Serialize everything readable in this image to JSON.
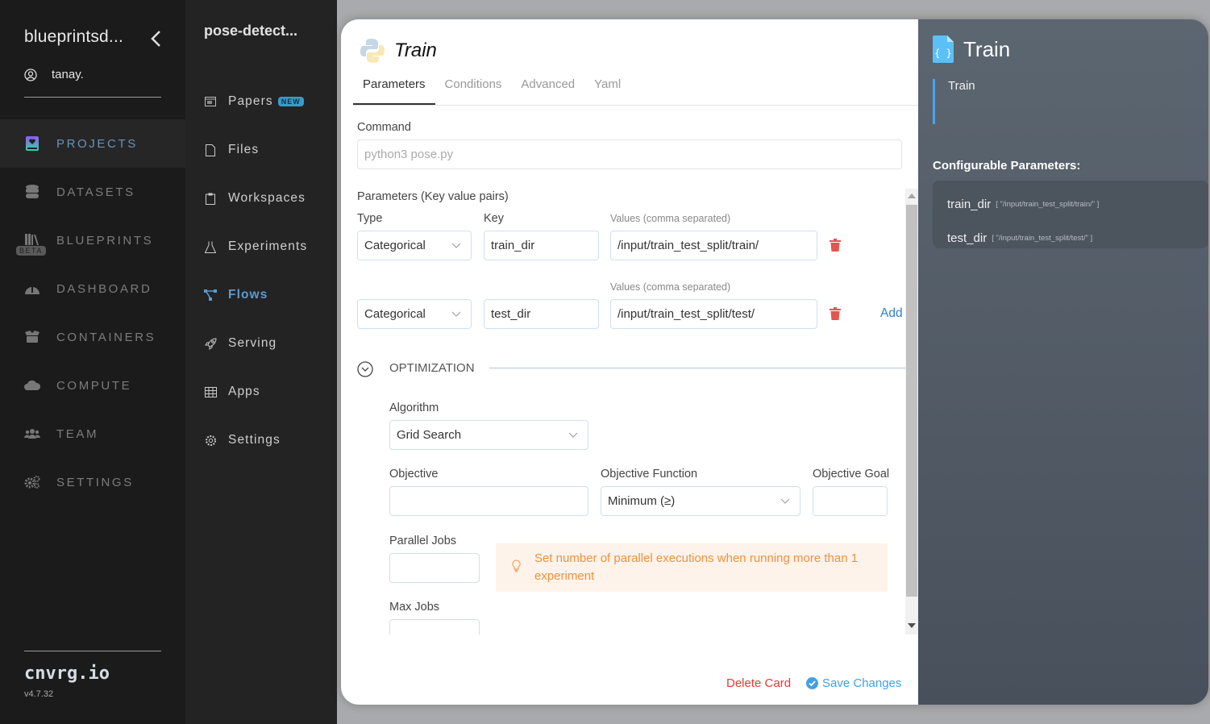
{
  "sidebar": {
    "org_name": "blueprintsd...",
    "username": "tanay.",
    "items": [
      {
        "label": "PROJECTS",
        "icon": "projects-icon",
        "active": true
      },
      {
        "label": "DATASETS",
        "icon": "database-icon"
      },
      {
        "label": "BLUEPRINTS",
        "icon": "blueprints-icon",
        "badge": "BETA"
      },
      {
        "label": "DASHBOARD",
        "icon": "dashboard-icon"
      },
      {
        "label": "CONTAINERS",
        "icon": "containers-icon"
      },
      {
        "label": "COMPUTE",
        "icon": "cloud-icon"
      },
      {
        "label": "TEAM",
        "icon": "team-icon"
      },
      {
        "label": "SETTINGS",
        "icon": "gears-icon"
      }
    ],
    "brand": "cnvrg.io",
    "version": "v4.7.32"
  },
  "project_nav": {
    "project_name": "pose-detect...",
    "items": [
      {
        "label": "Papers",
        "icon": "papers-icon",
        "badge": "NEW"
      },
      {
        "label": "Files",
        "icon": "file-icon"
      },
      {
        "label": "Workspaces",
        "icon": "clipboard-icon"
      },
      {
        "label": "Experiments",
        "icon": "flask-icon"
      },
      {
        "label": "Flows",
        "icon": "flows-icon",
        "active": true
      },
      {
        "label": "Serving",
        "icon": "rocket-icon"
      },
      {
        "label": "Apps",
        "icon": "grid-icon"
      },
      {
        "label": "Settings",
        "icon": "gear-icon"
      }
    ]
  },
  "modal": {
    "title": "Train",
    "tabs": [
      "Parameters",
      "Conditions",
      "Advanced",
      "Yaml"
    ],
    "active_tab": "Parameters",
    "command_label": "Command",
    "command_placeholder": "python3 pose.py",
    "params_label": "Parameters (Key value pairs)",
    "type_label": "Type",
    "key_label": "Key",
    "values_label": "Values (comma separated)",
    "params": [
      {
        "type": "Categorical",
        "key": "train_dir",
        "values": "/input/train_test_split/train/"
      },
      {
        "type": "Categorical",
        "key": "test_dir",
        "values": "/input/train_test_split/test/"
      }
    ],
    "add_label": "Add",
    "optimization": {
      "section_label": "OPTIMIZATION",
      "algorithm_label": "Algorithm",
      "algorithm_value": "Grid Search",
      "objective_label": "Objective",
      "objective_value": "",
      "objective_function_label": "Objective Function",
      "objective_function_value": "Minimum (≥)",
      "objective_goal_label": "Objective Goal",
      "objective_goal_value": "",
      "parallel_jobs_label": "Parallel Jobs",
      "parallel_jobs_value": "",
      "tip": "Set number of parallel executions when running more than 1 experiment",
      "max_jobs_label": "Max Jobs",
      "max_jobs_value": ""
    },
    "delete_label": "Delete Card",
    "save_label": "Save Changes"
  },
  "info_panel": {
    "title": "Train",
    "description": "Train",
    "configurable_label": "Configurable Parameters:",
    "params": [
      {
        "key": "train_dir",
        "value": "[ \"/input/train_test_split/train/\" ]"
      },
      {
        "key": "test_dir",
        "value": "[ \"/input/train_test_split/test/\" ]"
      }
    ]
  },
  "colors": {
    "accent": "#5a9ccd",
    "danger": "#e53935",
    "link": "#2f7fd6",
    "warning": "#f0913d"
  }
}
